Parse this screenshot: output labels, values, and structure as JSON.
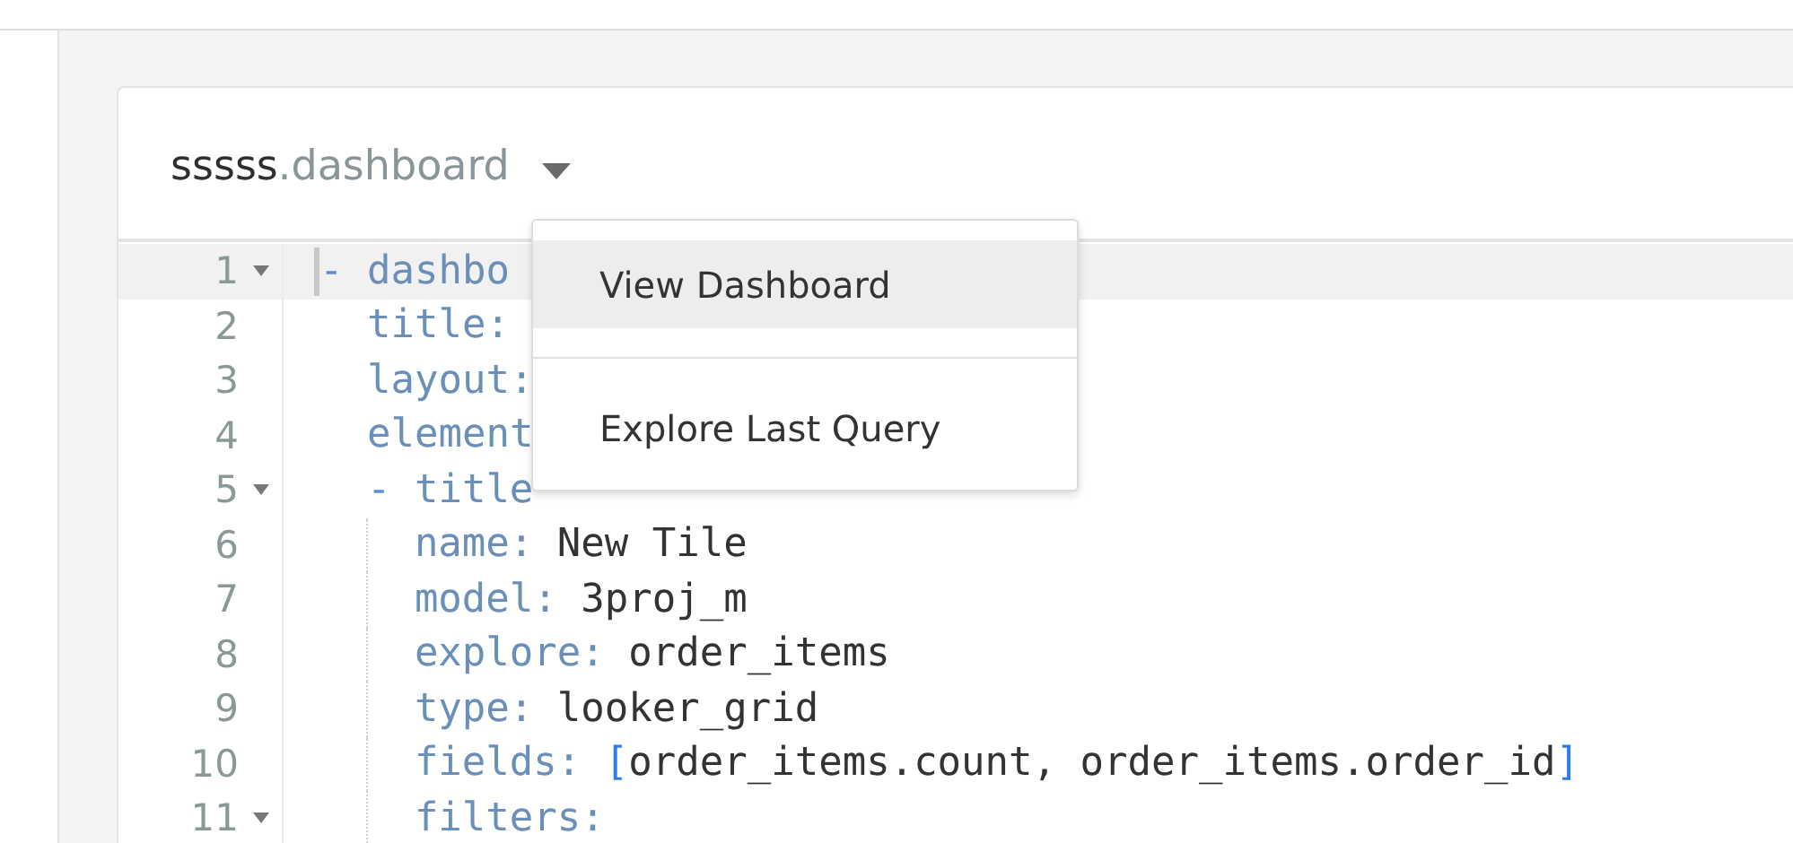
{
  "header": {
    "title_prefix": "sssss",
    "title_suffix": ".dashboard"
  },
  "editor": {
    "lines": [
      {
        "number": "1",
        "fold": true,
        "active": true,
        "segments": [
          {
            "kind": "dash",
            "text": "-"
          },
          {
            "kind": "key",
            "text": "dashbo"
          }
        ],
        "children": [
          {
            "number": "2",
            "fold": false,
            "active": false,
            "segments": [
              {
                "kind": "key",
                "text": "title:"
              }
            ]
          },
          {
            "number": "3",
            "fold": false,
            "active": false,
            "segments": [
              {
                "kind": "key",
                "text": "layout:"
              }
            ]
          },
          {
            "number": "4",
            "fold": false,
            "active": false,
            "segments": [
              {
                "kind": "key",
                "text": "element"
              }
            ],
            "children": [
              {
                "number": "5",
                "fold": true,
                "active": false,
                "segments": [
                  {
                    "kind": "dash",
                    "text": "-"
                  },
                  {
                    "kind": "key",
                    "text": "title"
                  }
                ],
                "children": [
                  {
                    "number": "6",
                    "fold": false,
                    "active": false,
                    "segments": [
                      {
                        "kind": "key",
                        "text": "name:"
                      },
                      {
                        "kind": "value",
                        "text": "New Tile"
                      }
                    ]
                  },
                  {
                    "number": "7",
                    "fold": false,
                    "active": false,
                    "segments": [
                      {
                        "kind": "key",
                        "text": "model:"
                      },
                      {
                        "kind": "value",
                        "text": "3proj_m"
                      }
                    ]
                  },
                  {
                    "number": "8",
                    "fold": false,
                    "active": false,
                    "segments": [
                      {
                        "kind": "key",
                        "text": "explore:"
                      },
                      {
                        "kind": "value",
                        "text": "order_items"
                      }
                    ]
                  },
                  {
                    "number": "9",
                    "fold": false,
                    "active": false,
                    "segments": [
                      {
                        "kind": "key",
                        "text": "type:"
                      },
                      {
                        "kind": "value",
                        "text": "looker_grid"
                      }
                    ]
                  },
                  {
                    "number": "10",
                    "fold": false,
                    "active": false,
                    "segments": [
                      {
                        "kind": "key",
                        "text": "fields:"
                      },
                      {
                        "kind": "bracket",
                        "text": "["
                      },
                      {
                        "kind": "value",
                        "text": "order_items.count, order_items.order_id"
                      },
                      {
                        "kind": "bracket",
                        "text": "]"
                      }
                    ]
                  },
                  {
                    "number": "11",
                    "fold": true,
                    "active": false,
                    "segments": [
                      {
                        "kind": "key",
                        "text": "filters:"
                      }
                    ]
                  }
                ]
              }
            ]
          }
        ]
      }
    ]
  },
  "menu": {
    "items": [
      {
        "kind": "item",
        "label": "View Dashboard",
        "selected": true
      },
      {
        "kind": "divider"
      },
      {
        "kind": "item",
        "label": "Explore Last Query",
        "selected": false
      }
    ]
  }
}
